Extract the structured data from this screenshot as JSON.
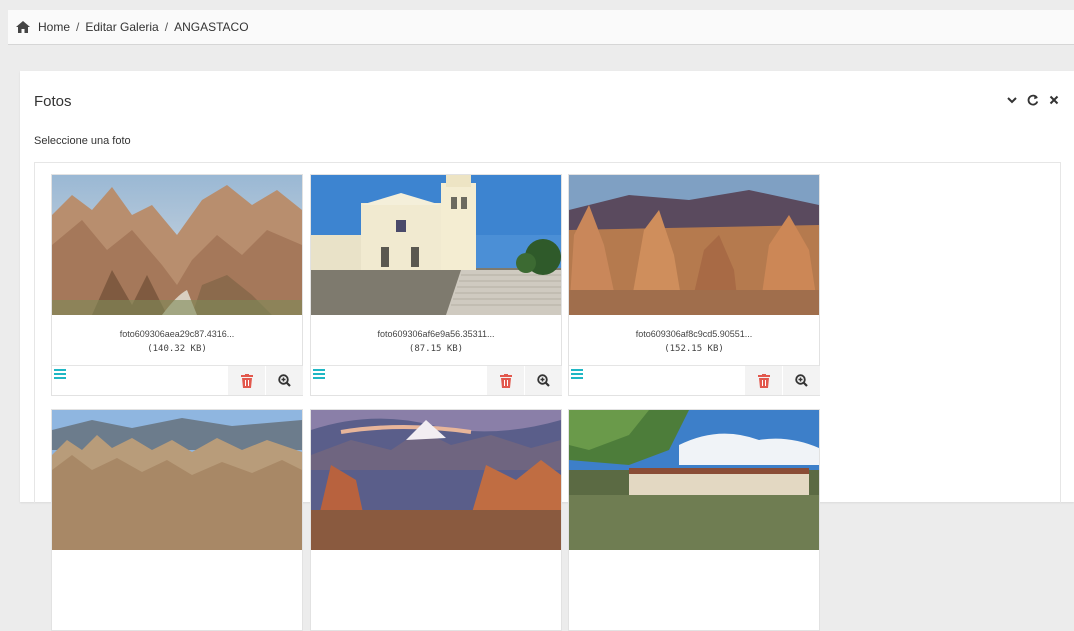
{
  "breadcrumb": {
    "home": "Home",
    "sep1": "/",
    "middle": "Editar Galeria",
    "sep2": "/",
    "current": "ANGASTACO"
  },
  "panel": {
    "title": "Fotos",
    "prompt": "Seleccione una foto"
  },
  "icons": {
    "home": "home-icon",
    "collapse": "chevron-down-icon",
    "refresh": "refresh-icon",
    "close": "close-icon",
    "drag": "drag-handle-icon",
    "delete": "trash-icon",
    "zoom": "zoom-in-icon"
  },
  "colors": {
    "accent_teal": "#1fb7c4",
    "delete_red": "#e2584d"
  },
  "photos": [
    {
      "name": "foto609306aea29c87.4316...",
      "size": "(140.32 KB)"
    },
    {
      "name": "foto609306af6e9a56.35311...",
      "size": "(87.15 KB)"
    },
    {
      "name": "foto609306af8c9cd5.90551...",
      "size": "(152.15 KB)"
    },
    {
      "name": "",
      "size": ""
    },
    {
      "name": "",
      "size": ""
    },
    {
      "name": "",
      "size": ""
    }
  ]
}
